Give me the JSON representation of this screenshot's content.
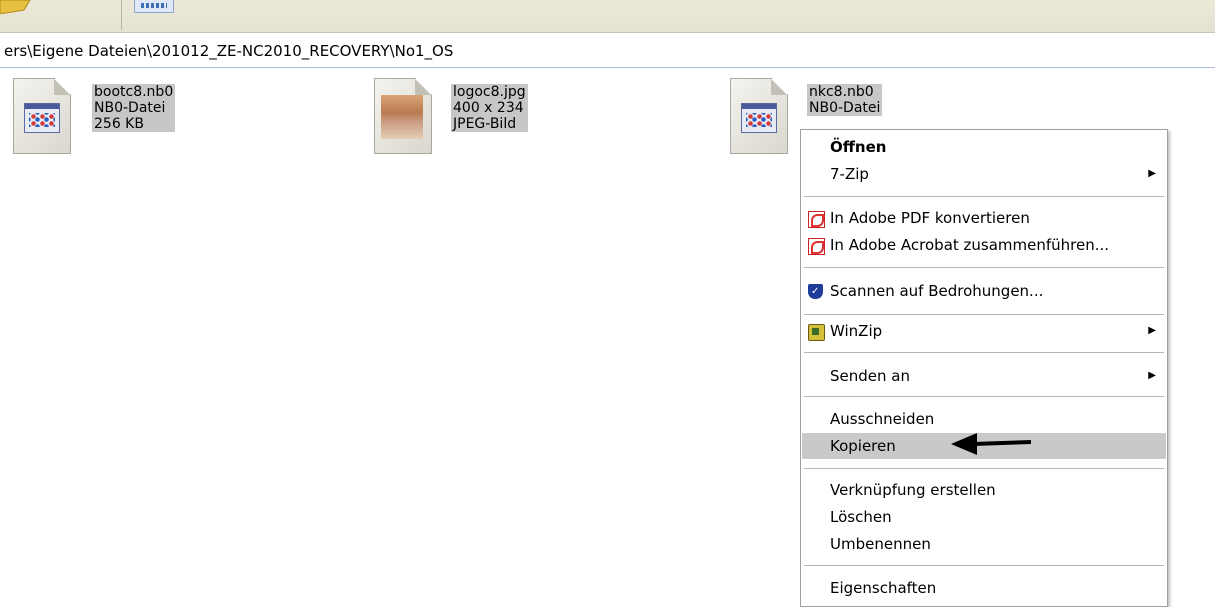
{
  "toolbar": {
    "folder_icon": "folder-icon",
    "view_icon": "views-icon"
  },
  "address": {
    "path": "ers\\Eigene Dateien\\201012_ZE-NC2010_RECOVERY\\No1_OS"
  },
  "files": [
    {
      "name": "bootc8.nb0",
      "type": "NB0-Datei",
      "info": "256 KB",
      "icon": "nb0-file-icon"
    },
    {
      "name": "logoc8.jpg",
      "type": "400 x 234",
      "info": "JPEG-Bild",
      "icon": "jpeg-image-icon"
    },
    {
      "name": "nkc8.nb0",
      "type": "NB0-Datei",
      "info": "",
      "icon": "nb0-file-icon"
    }
  ],
  "context_menu": {
    "open": "Öffnen",
    "sevenzip": "7-Zip",
    "pdf_convert": "In Adobe PDF konvertieren",
    "acrobat_merge": "In Adobe Acrobat zusammenführen...",
    "scan": "Scannen auf Bedrohungen...",
    "winzip": "WinZip",
    "send_to": "Senden an",
    "cut": "Ausschneiden",
    "copy": "Kopieren",
    "create_shortcut": "Verknüpfung erstellen",
    "delete": "Löschen",
    "rename": "Umbenennen",
    "properties": "Eigenschaften",
    "submenu_arrow": "▶"
  },
  "colors": {
    "highlight": "#c9c9c9",
    "selection": "#c7c7c7",
    "annotation_arrow": "#000000"
  }
}
